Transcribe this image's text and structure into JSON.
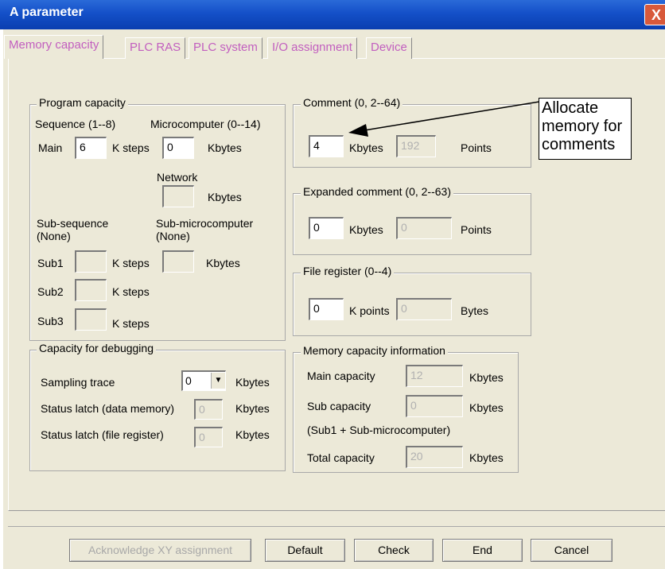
{
  "window": {
    "title": "A parameter",
    "close_label": "X"
  },
  "tabs": [
    "Memory capacity",
    "PLC RAS",
    "PLC system",
    "I/O assignment",
    "Device"
  ],
  "program_capacity": {
    "title": "Program capacity",
    "sequence_label": "Sequence (1--8)",
    "microcomputer_label": "Microcomputer (0--14)",
    "main_label": "Main",
    "main_value": "6",
    "k_steps": "K steps",
    "micro_value": "0",
    "kbytes": "Kbytes",
    "network_label": "Network",
    "network_value": "",
    "sub_sequence_label": "Sub-sequence",
    "sub_sequence_note": "(None)",
    "sub_micro_label": "Sub-microcomputer",
    "sub_micro_note": "(None)",
    "sub1_label": "Sub1",
    "sub2_label": "Sub2",
    "sub3_label": "Sub3"
  },
  "comment": {
    "title": "Comment (0, 2--64)",
    "value": "4",
    "unit": "Kbytes",
    "points_value": "192",
    "points_label": "Points"
  },
  "expanded_comment": {
    "title": "Expanded comment (0, 2--63)",
    "value": "0",
    "unit": "Kbytes",
    "points_value": "0",
    "points_label": "Points"
  },
  "file_register": {
    "title": "File register (0--4)",
    "value": "0",
    "unit": "K points",
    "bytes_value": "0",
    "bytes_label": "Bytes"
  },
  "debugging": {
    "title": "Capacity for debugging",
    "sampling_label": "Sampling trace",
    "sampling_value": "0",
    "status_data_label": "Status latch (data memory)",
    "status_data_value": "0",
    "status_file_label": "Status latch (file register)",
    "status_file_value": "0",
    "unit": "Kbytes"
  },
  "memory_info": {
    "title": "Memory capacity information",
    "main_label": "Main capacity",
    "main_value": "12",
    "sub_label": "Sub capacity",
    "sub_value": "0",
    "sub_note": "(Sub1 + Sub-microcomputer)",
    "total_label": "Total capacity",
    "total_value": "20",
    "unit": "Kbytes"
  },
  "callout": {
    "lines": [
      "Allocate",
      "memory for",
      "comments"
    ]
  },
  "buttons": {
    "ack": "Acknowledge XY assignment",
    "default": "Default",
    "check": "Check",
    "end": "End",
    "cancel": "Cancel"
  }
}
